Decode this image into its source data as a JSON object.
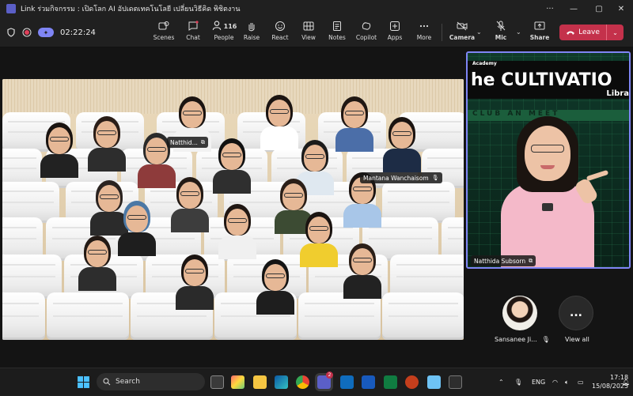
{
  "window": {
    "title": "Link ร่วมกิจกรรม : เปิดโลก AI อัปเดตเทคโนโลยี เปลี่ยนวิธีคิด พิชิตงาน"
  },
  "toolbar": {
    "timer": "02:22:24",
    "scenes": "Scenes",
    "chat": "Chat",
    "people": "People",
    "people_count": "116",
    "raise": "Raise",
    "react": "React",
    "view": "View",
    "notes": "Notes",
    "copilot": "Copilot",
    "apps": "Apps",
    "more": "More",
    "camera": "Camera",
    "mic": "Mic",
    "share": "Share",
    "leave": "Leave"
  },
  "stage": {
    "name_tags": [
      "Natthid...",
      "Mantana Wanchaisom"
    ],
    "spotlight": {
      "name": "Natthida Subsorn",
      "banner_small": "Academy",
      "banner_big": "he CULTIVATIO",
      "banner_sub": "Libra",
      "banner_club": "CLUB AN MEET"
    },
    "bottom": {
      "person_name": "Sansanee Ji...",
      "view_all": "View all",
      "view_all_icon": "..."
    }
  },
  "taskbar": {
    "search_placeholder": "Search",
    "teams_badge": "2",
    "language": "ENG",
    "time": "17:18",
    "date": "15/08/2025"
  },
  "colors": {
    "accent": "#7f85f5",
    "leave": "#c4314b",
    "titlebar": "#202020"
  }
}
